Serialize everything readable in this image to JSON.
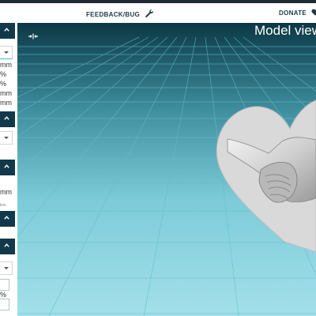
{
  "header": {
    "feedback_label": "FEEDBACK/BUG",
    "feedback_icon": "wrench-icon",
    "donate_label": "DONATE",
    "donate_icon": "heart-icon"
  },
  "sidebar": {
    "units": [
      "mm",
      "%",
      "%",
      "mm",
      "mm",
      "mm",
      "%"
    ],
    "tiny_label": "tive",
    "section_icon": "chevron-up-icon"
  },
  "viewport": {
    "title": "Model view",
    "toggle_icon": "collapse-arrows-icon",
    "model_icon": "heart-holding-hands-model",
    "colors": {
      "sky_top": "#0b3440",
      "floor_near": "#9fdde8",
      "grid": "#5fb9c9",
      "accent": "#12394a"
    }
  }
}
